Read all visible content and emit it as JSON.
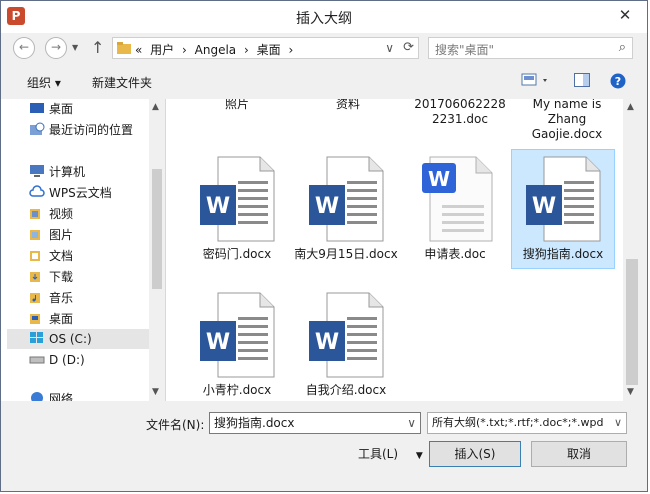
{
  "window": {
    "title": "插入大纲",
    "close": "✕"
  },
  "nav": {
    "back": "←",
    "forward": "→",
    "up": "↑",
    "breadcrumb": [
      "«",
      "用户",
      "›",
      "Angela",
      "›",
      "桌面",
      "›"
    ],
    "search_placeholder": "搜索\"桌面\""
  },
  "toolbar": {
    "organize": "组织 ▾",
    "new_folder": "新建文件夹"
  },
  "sidebar": {
    "items": [
      {
        "label": "桌面",
        "icon": "desktop-icon"
      },
      {
        "label": "最近访问的位置",
        "icon": "recent-icon"
      },
      {
        "label": "计算机",
        "icon": "computer-icon"
      },
      {
        "label": "WPS云文档",
        "icon": "cloud-icon"
      },
      {
        "label": "视频",
        "icon": "folder-icon"
      },
      {
        "label": "图片",
        "icon": "folder-icon"
      },
      {
        "label": "文档",
        "icon": "folder-icon"
      },
      {
        "label": "下载",
        "icon": "folder-icon"
      },
      {
        "label": "音乐",
        "icon": "folder-icon"
      },
      {
        "label": "桌面",
        "icon": "folder-icon"
      },
      {
        "label": "OS (C:)",
        "icon": "drive-icon"
      },
      {
        "label": "D (D:)",
        "icon": "drive-icon"
      },
      {
        "label": "网络",
        "icon": "network-icon"
      }
    ]
  },
  "files": {
    "top_row": [
      "照片",
      "资料",
      "201706062228 2231.doc",
      "My name is Zhang Gaojie.docx"
    ],
    "row2": [
      "密码门.docx",
      "南大9月15日.docx",
      "申请表.doc",
      "搜狗指南.docx"
    ],
    "row3": [
      "小青柠.docx",
      "自我介绍.docx"
    ],
    "selected": "搜狗指南.docx"
  },
  "bottom": {
    "filename_label": "文件名(N):",
    "filename_value": "搜狗指南.docx",
    "filetype_value": "所有大纲(*.txt;*.rtf;*.doc*;*.wpd",
    "tools": "工具(L)",
    "insert": "插入(S)",
    "cancel": "取消"
  },
  "colors": {
    "word_blue": "#2b579a",
    "wps_blue": "#2f63d8",
    "selection": "#cce8ff"
  }
}
